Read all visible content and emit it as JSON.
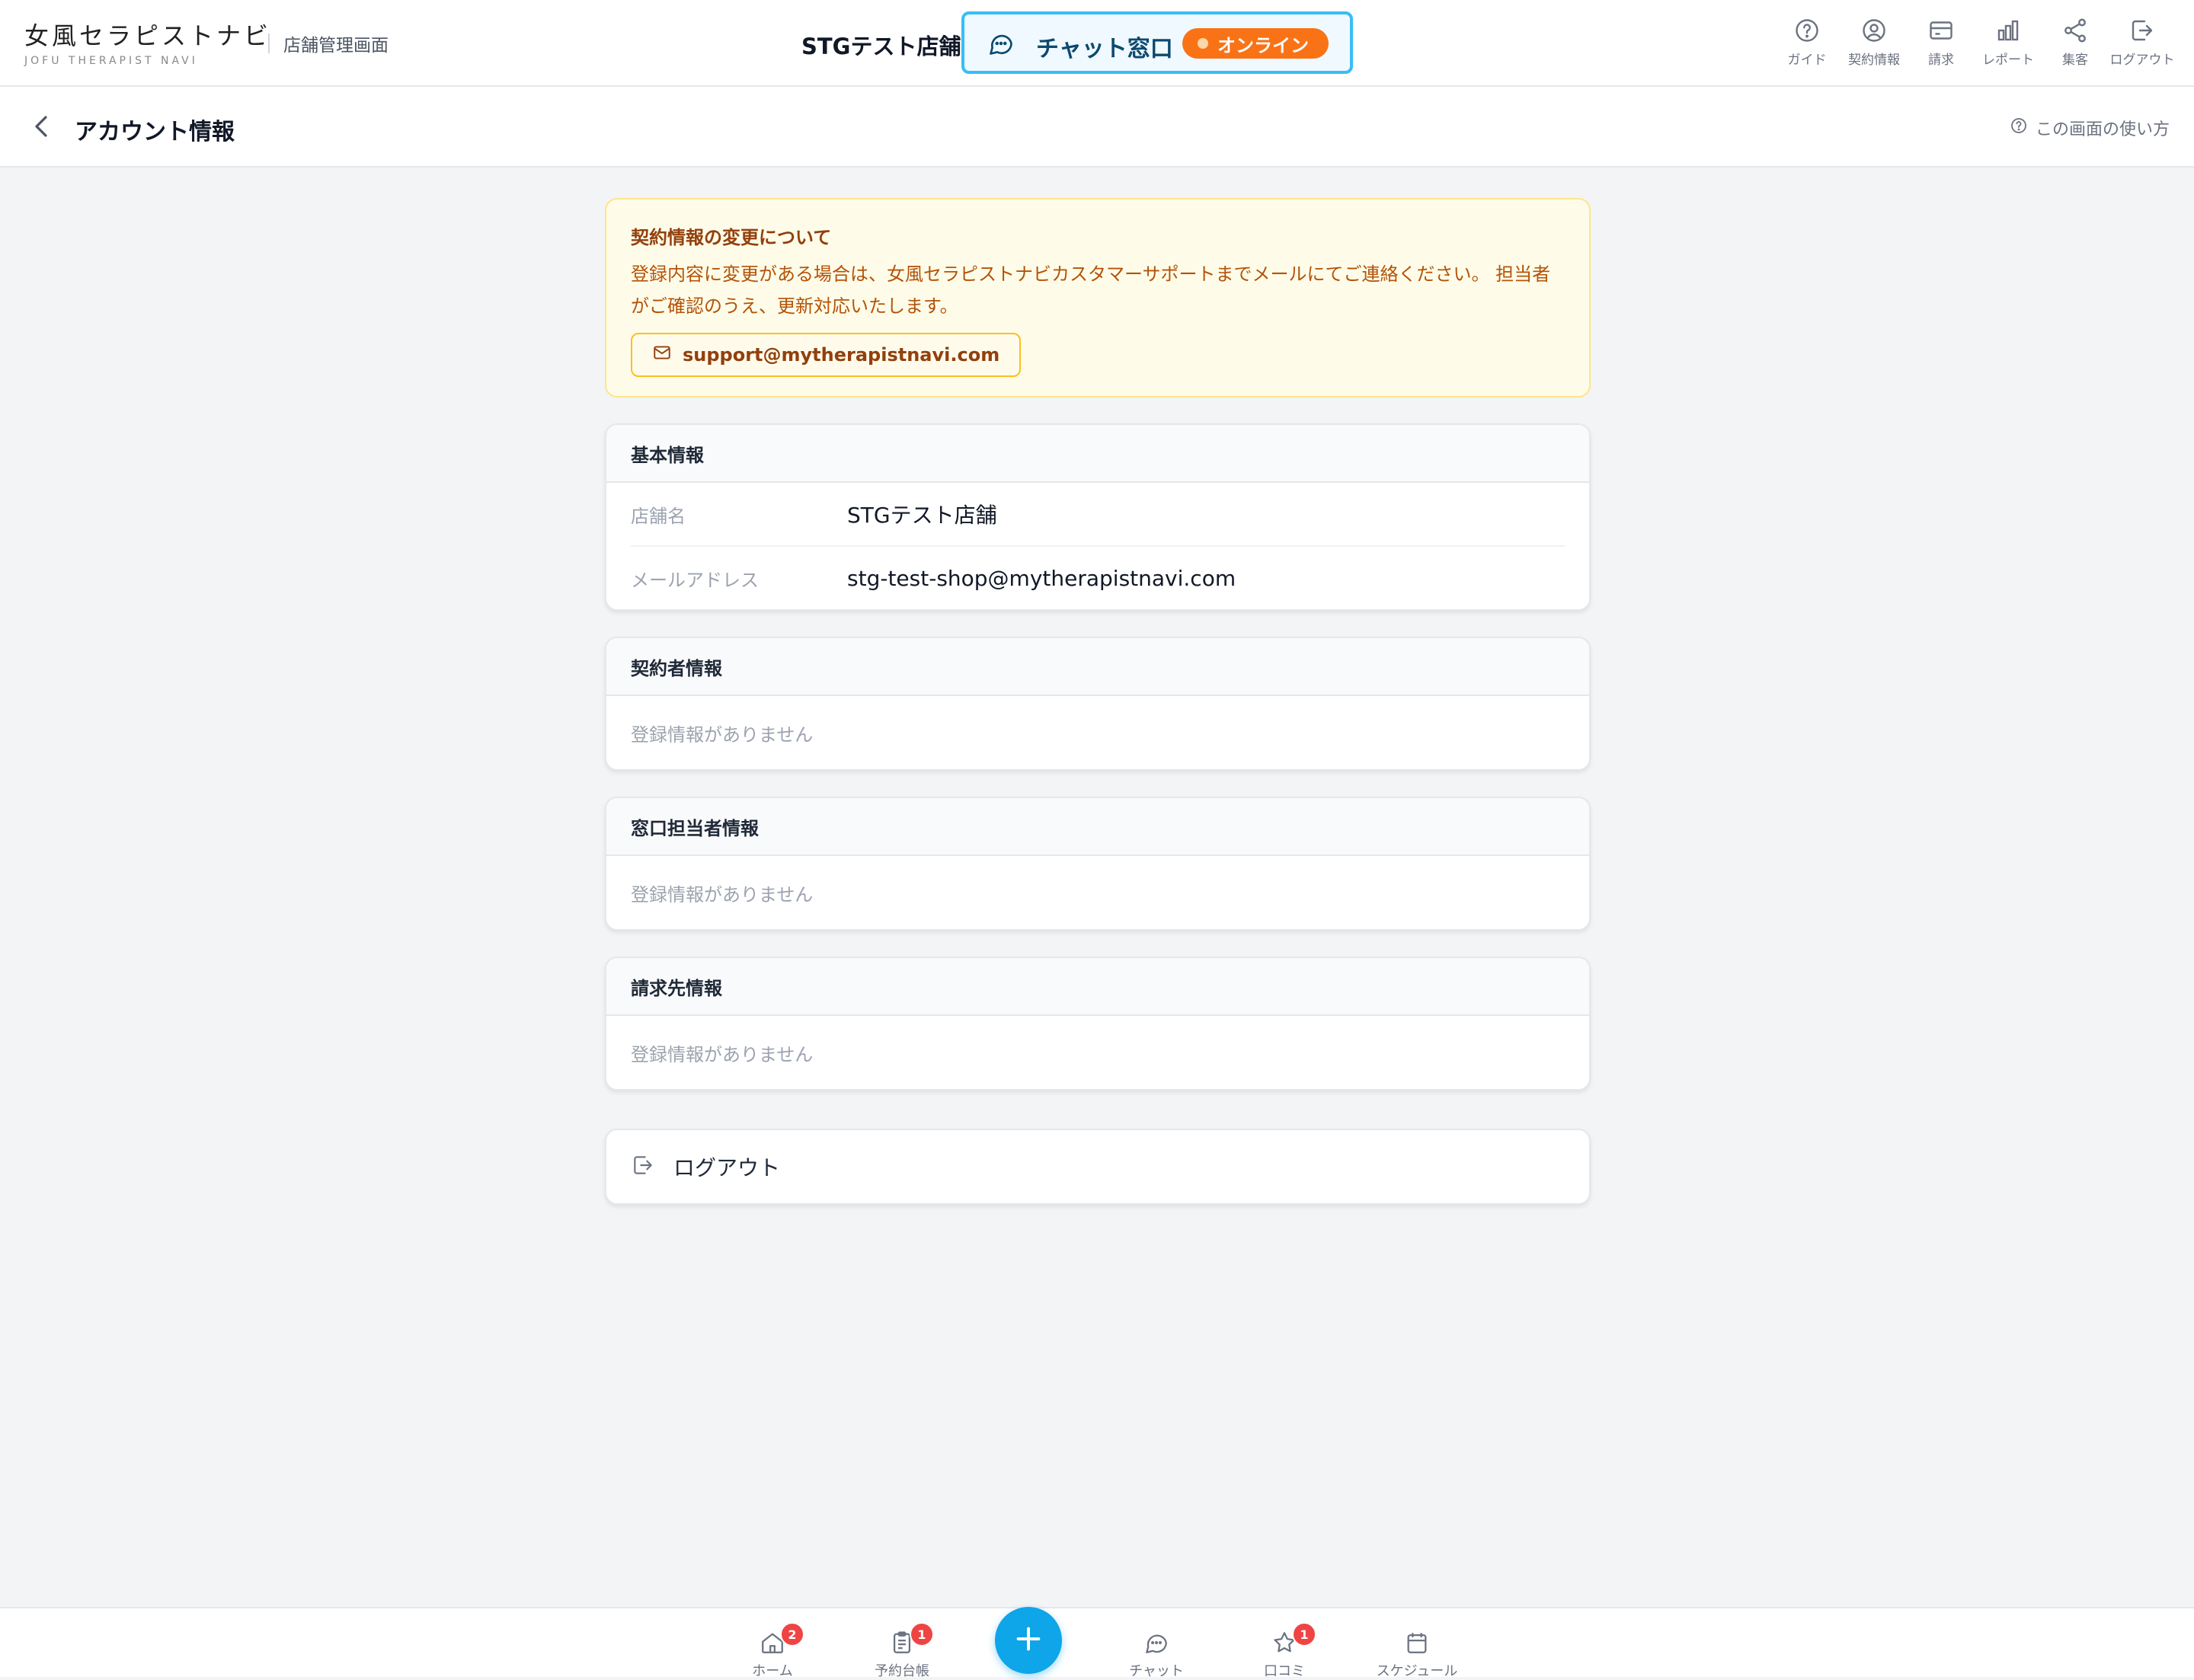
{
  "header": {
    "logo_main": "女風セラピストナビ",
    "logo_sub": "JOFU THERAPIST NAVI",
    "store_admin": "店舗管理画面",
    "store_name": "STGテスト店舗",
    "chat_window_label": "チャット窓口",
    "chat_status": "オンライン",
    "nav": [
      {
        "label": "ガイド",
        "icon": "help-circle-icon"
      },
      {
        "label": "契約情報",
        "icon": "user-circle-icon"
      },
      {
        "label": "請求",
        "icon": "credit-card-icon"
      },
      {
        "label": "レポート",
        "icon": "bar-chart-icon"
      },
      {
        "label": "集客",
        "icon": "share-icon"
      },
      {
        "label": "ログアウト",
        "icon": "logout-icon"
      }
    ]
  },
  "subheader": {
    "title": "アカウント情報",
    "help": "この画面の使い方"
  },
  "notice": {
    "title": "契約情報の変更について",
    "body": "登録内容に変更がある場合は、女風セラピストナビカスタマーサポートまでメールにてご連絡ください。 担当者がご確認のうえ、更新対応いたします。",
    "email": "support@mytherapistnavi.com"
  },
  "basic_info": {
    "title": "基本情報",
    "rows": [
      {
        "label": "店舗名",
        "value": "STGテスト店舗"
      },
      {
        "label": "メールアドレス",
        "value": "stg-test-shop@mytherapistnavi.com"
      }
    ]
  },
  "contractor_info": {
    "title": "契約者情報",
    "empty": "登録情報がありません"
  },
  "contact_info": {
    "title": "窓口担当者情報",
    "empty": "登録情報がありません"
  },
  "billing_info": {
    "title": "請求先情報",
    "empty": "登録情報がありません"
  },
  "logout_label": "ログアウト",
  "bottom_nav": [
    {
      "label": "ホーム",
      "badge": "2",
      "icon": "home-icon"
    },
    {
      "label": "予約台帳",
      "badge": "1",
      "icon": "clipboard-icon"
    },
    {
      "label": "チャット",
      "badge": "",
      "icon": "chat-icon"
    },
    {
      "label": "口コミ",
      "badge": "1",
      "icon": "star-icon"
    },
    {
      "label": "スケジュール",
      "badge": "",
      "icon": "calendar-icon"
    }
  ],
  "colors": {
    "accent": "#0ea5e9",
    "online": "#f97316",
    "notice_bg": "#fefce8",
    "badge": "#ef4444"
  }
}
